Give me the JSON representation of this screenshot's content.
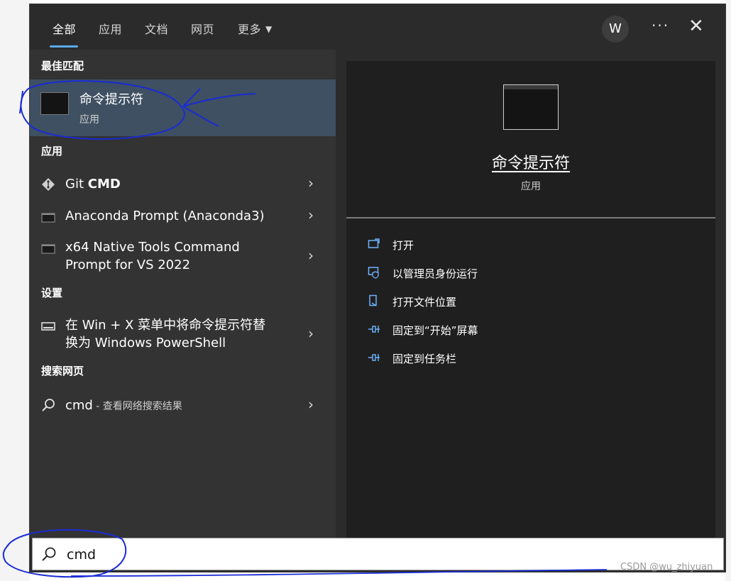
{
  "tabs": [
    {
      "label": "全部",
      "active": true
    },
    {
      "label": "应用",
      "active": false
    },
    {
      "label": "文档",
      "active": false
    },
    {
      "label": "网页",
      "active": false
    },
    {
      "label": "更多",
      "active": false
    }
  ],
  "more_arrow": "▼",
  "user_initial": "W",
  "more_options_icon": "···",
  "close_icon": "✕",
  "sections": {
    "best_match": "最佳匹配",
    "apps": "应用",
    "settings": "设置",
    "web_search": "搜索网页"
  },
  "best_match": {
    "title": "命令提示符",
    "subtitle": "应用"
  },
  "apps": [
    {
      "label_plain": "Git ",
      "label_bold": "CMD"
    },
    {
      "label_line1": "Anaconda Prompt (Anaconda3)"
    },
    {
      "label_line1": "x64 Native Tools Command",
      "label_line2": "Prompt for VS 2022"
    }
  ],
  "settings_item": {
    "label_line1": "在 Win + X 菜单中将命令提示符替",
    "label_line2": "换为 Windows PowerShell"
  },
  "web_search_item": {
    "query": "cmd",
    "suffix": " - 查看网络搜索结果"
  },
  "chevron": "›",
  "preview": {
    "title": "命令提示符",
    "subtitle": "应用"
  },
  "actions": [
    {
      "label": "打开",
      "icon": "open-icon"
    },
    {
      "label": "以管理员身份运行",
      "icon": "admin-shield-icon"
    },
    {
      "label": "打开文件位置",
      "icon": "file-location-icon"
    },
    {
      "label": "固定到“开始”屏幕",
      "icon": "pin-icon"
    },
    {
      "label": "固定到任务栏",
      "icon": "pin-icon"
    }
  ],
  "search": {
    "value": "cmd"
  },
  "watermark": "CSDN @wu_zhiyuan",
  "colors": {
    "panel": "#2b2b2b",
    "left_pane": "#333333",
    "right_pane": "#1f1f1f",
    "selected_row": "#3e5062",
    "accent": "#5aa9e6",
    "annotation": "#1a2bd6"
  }
}
